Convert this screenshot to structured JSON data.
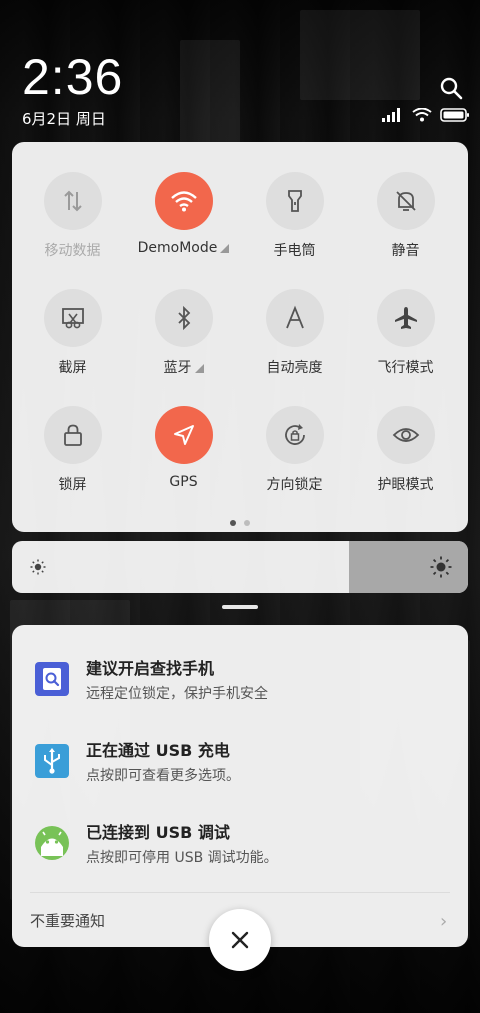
{
  "status_bar": {
    "time": "2:36",
    "date": "6月2日 周日"
  },
  "quick_settings": [
    {
      "label": "移动数据",
      "icon": "mobile-data-icon",
      "state": "disabled",
      "has_more": false
    },
    {
      "label": "DemoMode",
      "icon": "wifi-icon",
      "state": "active",
      "has_more": true
    },
    {
      "label": "手电筒",
      "icon": "flashlight-icon",
      "state": "off",
      "has_more": false
    },
    {
      "label": "静音",
      "icon": "mute-bell-icon",
      "state": "off",
      "has_more": false
    },
    {
      "label": "截屏",
      "icon": "screenshot-icon",
      "state": "off",
      "has_more": false
    },
    {
      "label": "蓝牙",
      "icon": "bluetooth-icon",
      "state": "off",
      "has_more": true
    },
    {
      "label": "自动亮度",
      "icon": "auto-brightness-icon",
      "state": "off",
      "has_more": false
    },
    {
      "label": "飞行模式",
      "icon": "airplane-icon",
      "state": "off",
      "has_more": false
    },
    {
      "label": "锁屏",
      "icon": "lock-icon",
      "state": "off",
      "has_more": false
    },
    {
      "label": "GPS",
      "icon": "gps-icon",
      "state": "active",
      "has_more": false
    },
    {
      "label": "方向锁定",
      "icon": "rotation-lock-icon",
      "state": "off",
      "has_more": false
    },
    {
      "label": "护眼模式",
      "icon": "eye-icon",
      "state": "off",
      "has_more": false
    }
  ],
  "pager": {
    "pages": 2,
    "current": 1
  },
  "brightness": {
    "level": 0.74
  },
  "notifications": [
    {
      "title": "建议开启查找手机",
      "text": "远程定位锁定，保护手机安全",
      "icon": "find-phone-icon"
    },
    {
      "title": "正在通过 USB 充电",
      "text": "点按即可查看更多选项。",
      "icon": "usb-icon"
    },
    {
      "title": "已连接到 USB 调试",
      "text": "点按即可停用 USB 调试功能。",
      "icon": "android-icon"
    }
  ],
  "unimportant_label": "不重要通知",
  "colors": {
    "accent": "#f2674c",
    "usb_icon_bg": "#3a9ed8",
    "find_phone_bg": "#4a5fd6",
    "android_green": "#78c257"
  }
}
